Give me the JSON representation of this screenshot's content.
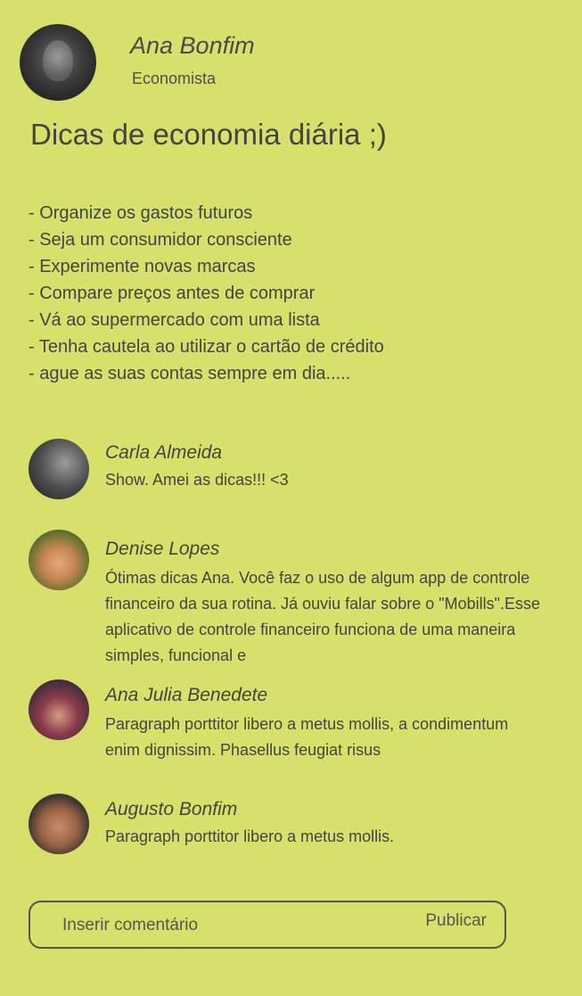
{
  "author": {
    "name": "Ana Bonfim",
    "role": "Economista"
  },
  "post": {
    "title": "Dicas de economia diária ;)",
    "tips": [
      "- Organize os gastos futuros",
      "- Seja um consumidor consciente",
      "- Experimente novas marcas",
      "- Compare preços antes de comprar",
      "- Vá ao supermercado com uma lista",
      "- Tenha cautela ao utilizar o cartão de crédito",
      "- ague as suas contas sempre em dia....."
    ]
  },
  "comments": [
    {
      "name": "Carla Almeida",
      "text": "Show. Amei as dicas!!! <3"
    },
    {
      "name": "Denise Lopes",
      "text": "Ótimas dicas Ana. Você faz o uso de algum app de controle financeiro da sua rotina. Já ouviu falar sobre o \"Mobills\".Esse aplicativo de controle financeiro funciona de uma maneira simples, funcional e"
    },
    {
      "name": "Ana Julia Benedete",
      "text": "Paragraph porttitor libero a metus mollis, a condimentum enim dignissim. Phasellus feugiat risus"
    },
    {
      "name": "Augusto Bonfim",
      "text": "Paragraph porttitor libero a metus mollis."
    }
  ],
  "comment_form": {
    "placeholder": "Inserir comentário",
    "publish_label": "Publicar"
  },
  "colors": {
    "background": "#d6e06a",
    "text": "#444444",
    "border": "#555555"
  }
}
